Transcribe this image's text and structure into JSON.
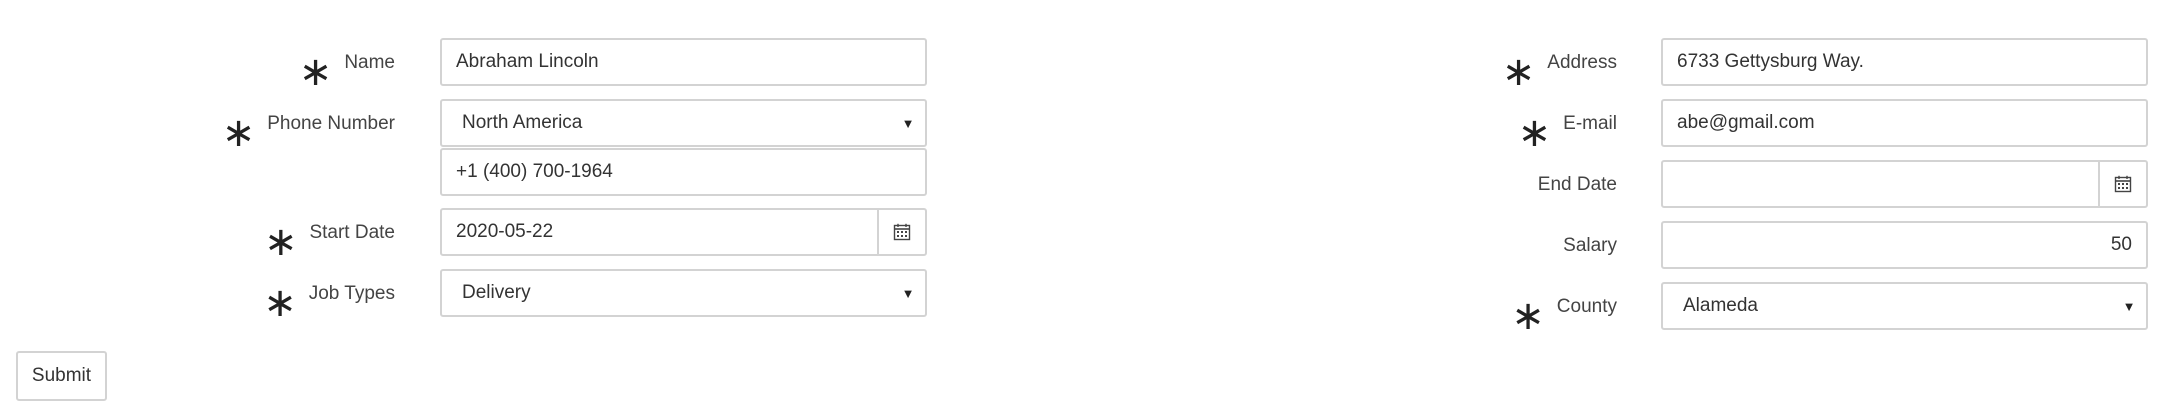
{
  "required_marker": "∗",
  "form": {
    "left": {
      "name": {
        "label": "Name",
        "value": "Abraham Lincoln"
      },
      "phone_number": {
        "label": "Phone Number",
        "region_selected": "North America",
        "number_value": "+1 (400) 700-1964"
      },
      "start_date": {
        "label": "Start Date",
        "value": "2020-05-22"
      },
      "job_types": {
        "label": "Job Types",
        "selected": "Delivery"
      }
    },
    "right": {
      "address": {
        "label": "Address",
        "value": "6733 Gettysburg Way."
      },
      "email": {
        "label": "E-mail",
        "value": "abe@gmail.com"
      },
      "end_date": {
        "label": "End Date",
        "value": ""
      },
      "salary": {
        "label": "Salary",
        "value": "50"
      },
      "county": {
        "label": "County",
        "selected": "Alameda"
      }
    }
  },
  "actions": {
    "submit_label": "Submit"
  },
  "icons": {
    "caret": "▼",
    "calendar": "calendar-icon"
  }
}
